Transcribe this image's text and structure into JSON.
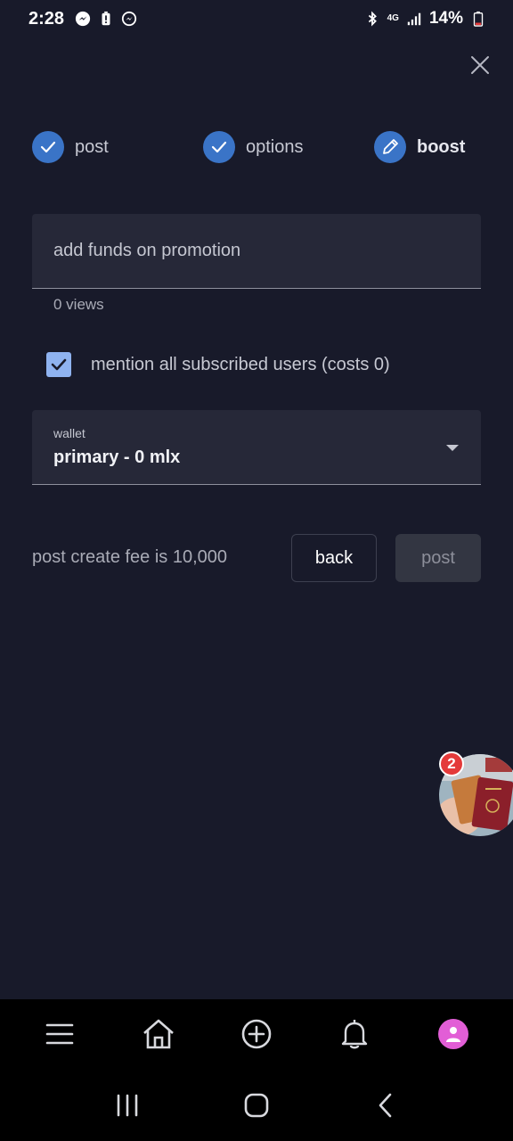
{
  "status_bar": {
    "time": "2:28",
    "battery": "14%",
    "network": "4G",
    "left_icons": [
      "messenger-icon",
      "battery-alert-icon",
      "messenger-icon"
    ],
    "right_icons": [
      "bluetooth-icon",
      "network-4g-icon",
      "signal-icon",
      "battery-icon"
    ]
  },
  "stepper": {
    "steps": [
      {
        "label": "post",
        "state": "done",
        "icon": "check-icon"
      },
      {
        "label": "options",
        "state": "done",
        "icon": "check-icon"
      },
      {
        "label": "boost",
        "state": "active",
        "icon": "pencil-icon"
      }
    ]
  },
  "promotion": {
    "placeholder": "add funds on promotion",
    "helper": "0 views"
  },
  "mention": {
    "label": "mention all subscribed users (costs 0)",
    "checked": true
  },
  "wallet": {
    "caption": "wallet",
    "value": "primary - 0 mlx"
  },
  "footer": {
    "fee_text": "post create fee is 10,000",
    "back_label": "back",
    "post_label": "post"
  },
  "chat_head": {
    "badge_count": "2"
  },
  "app_nav": {
    "items": [
      "menu-icon",
      "home-icon",
      "add-circle-icon",
      "bell-icon",
      "avatar"
    ]
  },
  "colors": {
    "background": "#181a2a",
    "field": "#262838",
    "accent": "#3a74c7",
    "checkbox": "#8fb3f0",
    "avatar": "#e25ed6",
    "badge": "#e43a3a"
  }
}
